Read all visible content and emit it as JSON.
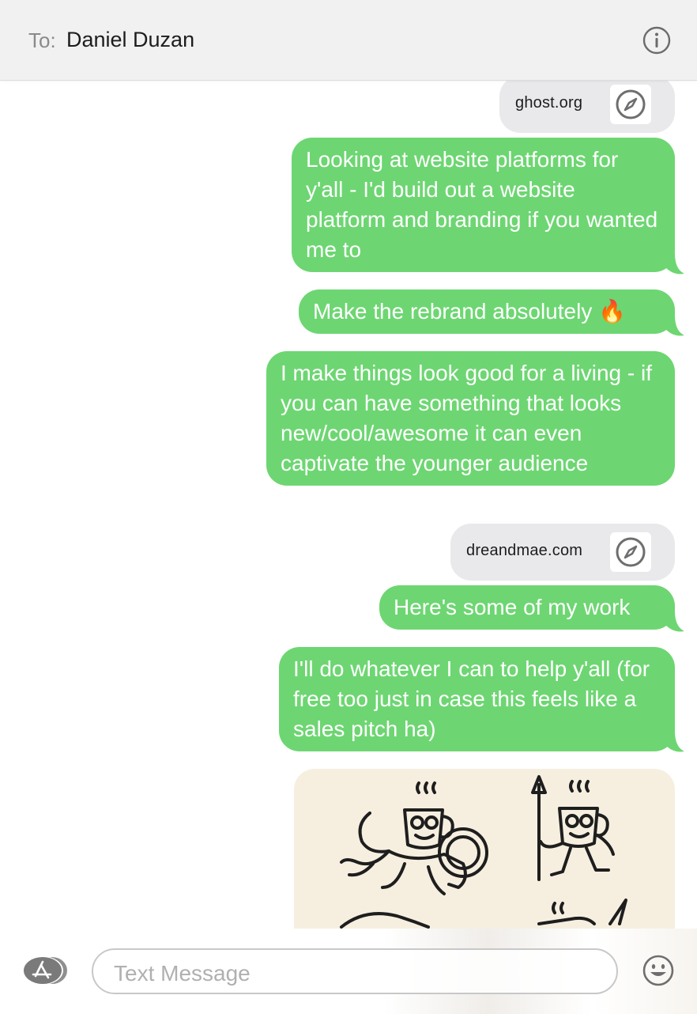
{
  "header": {
    "to_label": "To:",
    "recipient": "Daniel Duzan"
  },
  "messages": [
    {
      "type": "link",
      "text": "ghost.org",
      "icon": "compass-icon"
    },
    {
      "type": "sent",
      "text": "Looking at website platforms for y'all - I'd build out a website platform and branding if you wanted me to"
    },
    {
      "type": "sent",
      "text": "Make the rebrand absolutely 🔥"
    },
    {
      "type": "sent",
      "text": "I make things look good for a living - if you can have something that looks new/cool/awesome it can even captivate the younger audience"
    },
    {
      "type": "link",
      "text": "dreandmae.com",
      "icon": "compass-icon"
    },
    {
      "type": "sent",
      "text": "Here's some of my work"
    },
    {
      "type": "sent",
      "text": "I'll do whatever I can to help y'all (for free too just in case this feels like a sales pitch ha)"
    },
    {
      "type": "image",
      "icon": "mascot-illustration-image"
    }
  ],
  "compose": {
    "placeholder": "Text Message",
    "apps_icon": "app-store-icon",
    "emoji_icon": "emoji-icon"
  },
  "colors": {
    "sent_bubble": "#6dd672",
    "link_bubble": "#e9e9eb",
    "header_bg": "#f1f1f1"
  }
}
